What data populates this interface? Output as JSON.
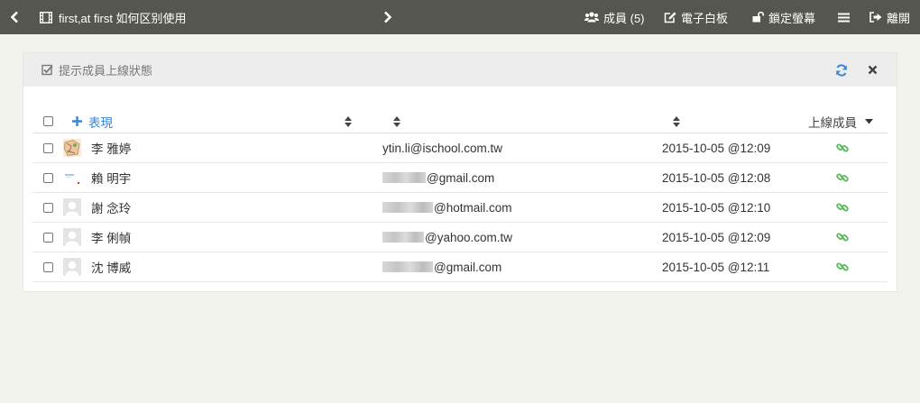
{
  "topbar": {
    "title": "first,at first 如何区别使用",
    "members_label": "成員 (5)",
    "whiteboard_label": "電子白板",
    "lock_label": "鎖定螢幕",
    "leave_label": "離開"
  },
  "panel": {
    "title": "提示成員上線狀態"
  },
  "table": {
    "header": {
      "add_label": "表現",
      "online_label": "上線成員"
    },
    "rows": [
      {
        "name": "李 雅婷",
        "email": "ytin.li@ischool.com.tw",
        "time": "2015-10-05 @12:09"
      },
      {
        "name": "賴 明宇",
        "email": "@gmail.com",
        "time": "2015-10-05 @12:08"
      },
      {
        "name": "謝 念玲",
        "email": "@hotmail.com",
        "time": "2015-10-05 @12:10"
      },
      {
        "name": "李 俐幀",
        "email": "@yahoo.com.tw",
        "time": "2015-10-05 @12:09"
      },
      {
        "name": "沈 博威",
        "email": "@gmail.com",
        "time": "2015-10-05 @12:11"
      }
    ]
  },
  "colors": {
    "topbar_bg": "#555650",
    "page_bg": "#f3f3ee",
    "accent_blue": "#3a86d6",
    "online_green": "#5cb85c"
  }
}
